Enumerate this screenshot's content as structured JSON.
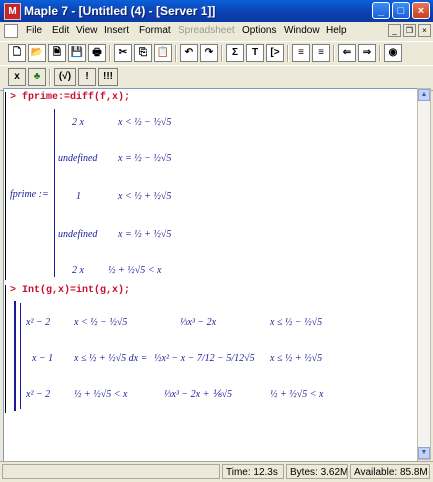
{
  "window": {
    "title": "Maple 7 - [Untitled (4) - [Server 1]]"
  },
  "menus": [
    {
      "label": "File",
      "disabled": false
    },
    {
      "label": "Edit",
      "disabled": false
    },
    {
      "label": "View",
      "disabled": false
    },
    {
      "label": "Insert",
      "disabled": false
    },
    {
      "label": "Format",
      "disabled": false
    },
    {
      "label": "Spreadsheet",
      "disabled": true
    },
    {
      "label": "Options",
      "disabled": false
    },
    {
      "label": "Window",
      "disabled": false
    },
    {
      "label": "Help",
      "disabled": false
    }
  ],
  "toolbar1": [
    {
      "name": "new-file-icon",
      "glyph": "🗋"
    },
    {
      "name": "open-file-icon",
      "glyph": "📂"
    },
    {
      "name": "open-url-icon",
      "glyph": "🗎"
    },
    {
      "name": "save-icon",
      "glyph": "💾"
    },
    {
      "name": "print-icon",
      "glyph": "🖶"
    },
    {
      "name": "cut-icon",
      "glyph": "✂"
    },
    {
      "name": "copy-icon",
      "glyph": "⎘"
    },
    {
      "name": "paste-icon",
      "glyph": "📋"
    },
    {
      "name": "undo-icon",
      "glyph": "↶"
    },
    {
      "name": "redo-icon",
      "glyph": "↷"
    },
    {
      "name": "sigma-icon",
      "glyph": "Σ"
    },
    {
      "name": "text-mode-icon",
      "glyph": "T"
    },
    {
      "name": "prompt-icon",
      "glyph": "[>"
    },
    {
      "name": "indent-icon",
      "glyph": "≡"
    },
    {
      "name": "outdent-icon",
      "glyph": "≡"
    },
    {
      "name": "back-icon",
      "glyph": "⇐"
    },
    {
      "name": "forward-icon",
      "glyph": "⇒"
    },
    {
      "name": "stop-icon",
      "glyph": "◉"
    }
  ],
  "toolbar2": [
    {
      "name": "maple-notation-icon",
      "glyph": "x"
    },
    {
      "name": "leaf-icon",
      "glyph": "♣"
    },
    {
      "name": "check-syntax-icon",
      "glyph": "(√)"
    },
    {
      "name": "execute-icon",
      "glyph": "!"
    },
    {
      "name": "execute-all-icon",
      "glyph": "!!!"
    }
  ],
  "worksheet": {
    "input1": "> fprime:=diff(f,x);",
    "lhs1": "fprime :=",
    "piece1": [
      {
        "expr": "2 x",
        "cond": "x < ½ − ½√5"
      },
      {
        "expr": "undefined",
        "cond": "x = ½ − ½√5"
      },
      {
        "expr": "1",
        "cond": "x < ½ + ½√5"
      },
      {
        "expr": "undefined",
        "cond": "x = ½ + ½√5"
      },
      {
        "expr": "2 x",
        "cond": "½ + ½√5 < x"
      }
    ],
    "input2": "> Int(g,x)=int(g,x);",
    "piece2": [
      {
        "expr": "x² − 2",
        "cond": "x < ½ − ½√5",
        "rhs": "⅓x³ − 2x",
        "rcond": "x ≤ ½ − ½√5"
      },
      {
        "expr": "x − 1",
        "cond": "x ≤ ½ + ½√5 dx =",
        "rhs": "½x² − x − 7/12 − 5/12√5",
        "rcond": "x ≤ ½ + ½√5"
      },
      {
        "expr": "x² − 2",
        "cond": "½ + ½√5 < x",
        "rhs": "⅓x³ − 2x + ⅙√5",
        "rcond": "½ + ½√5 < x"
      }
    ]
  },
  "status": {
    "time": "Time: 12.3s",
    "bytes": "Bytes: 3.62M",
    "available": "Available: 85.8M"
  }
}
